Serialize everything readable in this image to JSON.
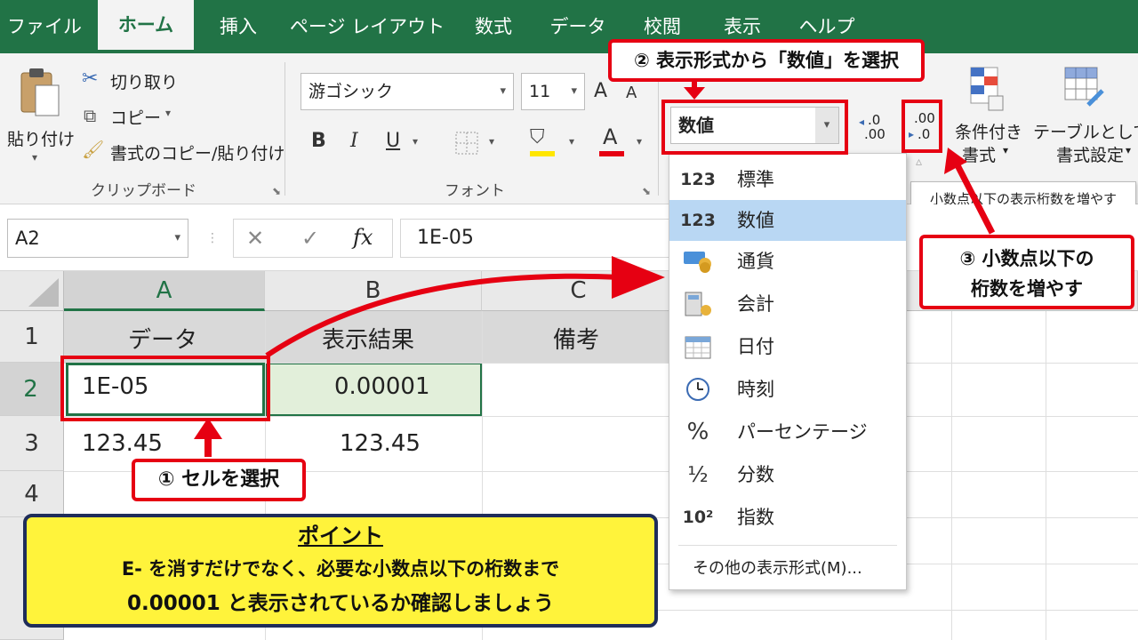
{
  "tabs": [
    "ファイル",
    "ホーム",
    "挿入",
    "ページ レイアウト",
    "数式",
    "データ",
    "校閲",
    "表示",
    "ヘルプ"
  ],
  "ribbon": {
    "paste_label": "貼り付け",
    "cut_label": "切り取り",
    "copy_label": "コピー",
    "format_painter_label": "書式のコピー/貼り付け",
    "clipboard_group": "クリップボード",
    "font_name": "游ゴシック",
    "font_size": "11",
    "grow_font": "A",
    "shrink_font": "A",
    "bold": "B",
    "italic": "I",
    "underline": "U",
    "font_color_letter": "A",
    "font_group": "フォント",
    "number_format": "数値",
    "increase_decimal_top": ".00",
    "increase_decimal_bottom": ".0",
    "decrease_decimal_top": ".0",
    "decrease_decimal_bottom": ".00",
    "conditional_format_line1": "条件付き",
    "conditional_format_line2": "書式",
    "table_format_line1": "テーブルとして",
    "table_format_line2": "書式設定"
  },
  "tooltip": "小数点以下の表示桁数を増やす",
  "formula_bar": {
    "name_box": "A2",
    "cancel_symbol": "✕",
    "enter_symbol": "✓",
    "fx_label": "fx",
    "value": "1E-05"
  },
  "sheet": {
    "columns": [
      "A",
      "B",
      "C"
    ],
    "rows": [
      "1",
      "2",
      "3",
      "4"
    ],
    "cells": {
      "A1": "データ",
      "B1": "表示結果",
      "C1": "備考",
      "A2": "1E-05",
      "B2": "0.00001",
      "A3": "123.45",
      "B3": "123.45"
    }
  },
  "dropdown": {
    "items": [
      {
        "icon": "123",
        "label": "標準"
      },
      {
        "icon": "123",
        "label": "数値"
      },
      {
        "icon": "",
        "label": "通貨"
      },
      {
        "icon": "",
        "label": "会計"
      },
      {
        "icon": "",
        "label": "日付"
      },
      {
        "icon": "",
        "label": "時刻"
      },
      {
        "icon": "%",
        "label": "パーセンテージ"
      },
      {
        "icon": "½",
        "label": "分数"
      },
      {
        "icon": "10²",
        "label": "指数"
      }
    ],
    "more_label": "その他の表示形式(M)..."
  },
  "callouts": {
    "step1": "① セルを選択",
    "step2": "② 表示形式から「数値」を選択",
    "step3_line1": "③ 小数点以下の",
    "step3_line2": "桁数を増やす"
  },
  "point": {
    "title": "ポイント",
    "line1": "E- を消すだけでなく、必要な小数点以下の桁数まで",
    "line2": "0.00001 と表示されているか確認しましょう"
  },
  "colors": {
    "excel_green": "#217346",
    "callout_red": "#e60012",
    "highlight_blue": "#b9d7f3",
    "point_yellow": "#fff33b",
    "point_border": "#1f2d5a"
  }
}
